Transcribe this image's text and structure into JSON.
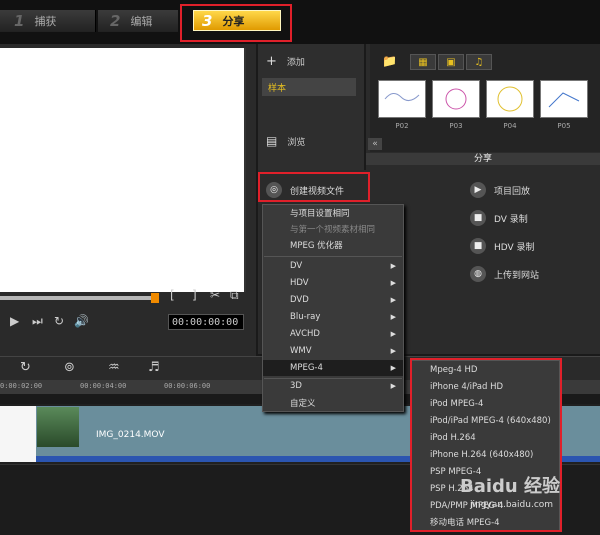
{
  "steps": [
    {
      "num": "1",
      "label": "捕获"
    },
    {
      "num": "2",
      "label": "编辑"
    },
    {
      "num": "3",
      "label": "分享"
    }
  ],
  "library": {
    "add_label": "添加",
    "sample_label": "样本",
    "browse_label": "浏览",
    "thumbs": [
      "P02",
      "P03",
      "P04",
      "P05"
    ],
    "share_header": "分享"
  },
  "share_actions": {
    "create_video": "创建视频文件",
    "project_playback": "项目回放",
    "dv_record": "DV 录制",
    "hdv_record": "HDV 录制",
    "upload_web": "上传到网站"
  },
  "player": {
    "timecode": "00:00:00:00",
    "mark_in": "[",
    "mark_out": "]"
  },
  "menu_main": [
    {
      "label": "与项目设置相同",
      "disabled": false,
      "submenu": false
    },
    {
      "label": "与第一个视频素材相同",
      "disabled": true,
      "submenu": false
    },
    {
      "label": "MPEG 优化器",
      "disabled": false,
      "submenu": false
    },
    {
      "label": "DV",
      "disabled": false,
      "submenu": true
    },
    {
      "label": "HDV",
      "disabled": false,
      "submenu": true
    },
    {
      "label": "DVD",
      "disabled": false,
      "submenu": true
    },
    {
      "label": "Blu-ray",
      "disabled": false,
      "submenu": true
    },
    {
      "label": "AVCHD",
      "disabled": false,
      "submenu": true
    },
    {
      "label": "WMV",
      "disabled": false,
      "submenu": true
    },
    {
      "label": "MPEG-4",
      "disabled": false,
      "submenu": true
    },
    {
      "label": "3D",
      "disabled": false,
      "submenu": true
    },
    {
      "label": "自定义",
      "disabled": false,
      "submenu": false
    }
  ],
  "menu_mpeg4": [
    "Mpeg-4 HD",
    "iPhone 4/iPad HD",
    "iPod MPEG-4",
    "iPod/iPad MPEG-4 (640x480)",
    "iPod H.264",
    "iPhone H.264 (640x480)",
    "PSP MPEG-4",
    "PSP H.264",
    "PDA/PMP MPEG-4",
    "移动电话 MPEG-4"
  ],
  "timeline": {
    "ticks": [
      "0:00:02:00",
      "00:00:04:00",
      "00:00:06:00"
    ],
    "clip_name": "IMG_0214.MOV"
  },
  "watermark": {
    "brand": "Baidu 经验",
    "url": "jingyan.baidu.com"
  }
}
